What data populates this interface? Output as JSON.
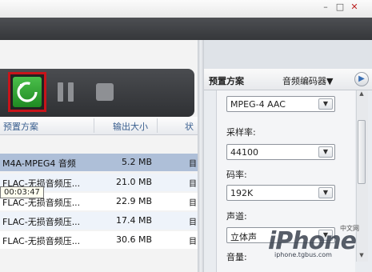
{
  "window": {
    "minimize": "–",
    "restore": "□",
    "close": "✕"
  },
  "toolbar": {
    "convert_icon": "refresh-arrow-icon",
    "pause_icon": "pause-icon",
    "stop_icon": "stop-icon",
    "convert_color": "#2e9e33",
    "highlight_color": "#c8141a"
  },
  "table": {
    "headers": [
      "预置方案",
      "输出大小",
      "状"
    ],
    "rows": [
      {
        "preset": "M4A-MPEG4 音频",
        "size": "5.2 MB",
        "status": "目",
        "selected": true
      },
      {
        "preset": "FLAC-无损音频压...",
        "size": "21.0 MB",
        "status": "目"
      },
      {
        "preset": "FLAC-无损音频压...",
        "size": "22.9 MB",
        "status": "目"
      },
      {
        "preset": "FLAC-无损音频压...",
        "size": "17.4 MB",
        "status": "目"
      },
      {
        "preset": "FLAC-无损音频压...",
        "size": "30.6 MB",
        "status": "目"
      }
    ],
    "tooltip": "00:03:47"
  },
  "right_panel": {
    "title": "预置方案",
    "tab": "音频编码器▼",
    "next_icon": "chevron-right-icon",
    "codec_value": "MPEG-4 AAC",
    "sample_rate_label": "采样率:",
    "sample_rate_value": "44100",
    "bitrate_label": "码率:",
    "bitrate_value": "192K",
    "channel_label": "声道:",
    "channel_value": "立体声",
    "volume_label": "音量:"
  },
  "watermark": {
    "brand": "iPhone",
    "tag": "中文网",
    "url": "iphone.tgbus.com"
  }
}
